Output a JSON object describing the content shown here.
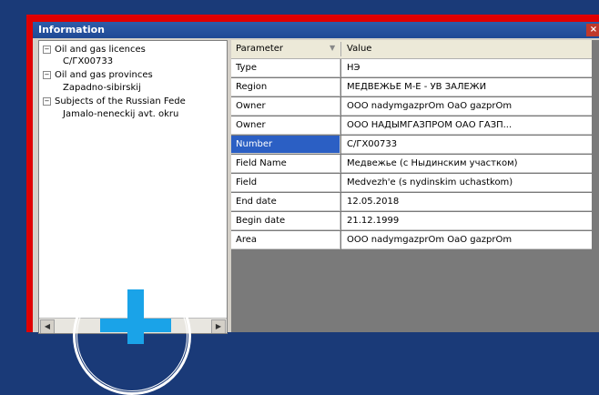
{
  "window": {
    "title": "Information",
    "close_glyph": "×"
  },
  "tree": {
    "nodes": [
      {
        "label": "Oil and gas licences",
        "expander": "⊟"
      },
      {
        "label": "С/ГХ00733"
      },
      {
        "label": "Oil and gas provinces",
        "expander": "⊟"
      },
      {
        "label": "Zapadno-sibirskij"
      },
      {
        "label": "Subjects of the Russian Fede",
        "expander": "⊟"
      },
      {
        "label": "Jamalo-neneckij avt. okru"
      }
    ],
    "scroll_left": "◀",
    "scroll_right": "▶"
  },
  "grid": {
    "columns": [
      "Parameter",
      "Value"
    ],
    "sort_glyph": "▼",
    "rows": [
      {
        "param": "Type",
        "value": "НЭ"
      },
      {
        "param": "Region",
        "value": "МЕДВЕЖЬЕ М-Е - УВ ЗАЛЕЖИ"
      },
      {
        "param": "Owner",
        "value": "OOO nadymgazprOm OaO gazprOm"
      },
      {
        "param": "Owner",
        "value": "ООО НАДЫМГАЗПРОМ ОАО ГАЗП..."
      },
      {
        "param": "Number",
        "value": "С/ГХ00733",
        "selected": true
      },
      {
        "param": "Field Name",
        "value": "Медвежье (с Ныдинским участком)"
      },
      {
        "param": "Field",
        "value": "Medvezh'e (s nydinskim uchastkom)"
      },
      {
        "param": "End date",
        "value": "12.05.2018"
      },
      {
        "param": "Begin date",
        "value": "21.12.1999"
      },
      {
        "param": "Area",
        "value": "OOO nadymgazprOm OaO gazprOm"
      }
    ]
  },
  "colors": {
    "selection": "#2b5fc4",
    "frame": "#e00000",
    "background": "#1a3a78",
    "overlay_plus": "#1aa3e8"
  }
}
